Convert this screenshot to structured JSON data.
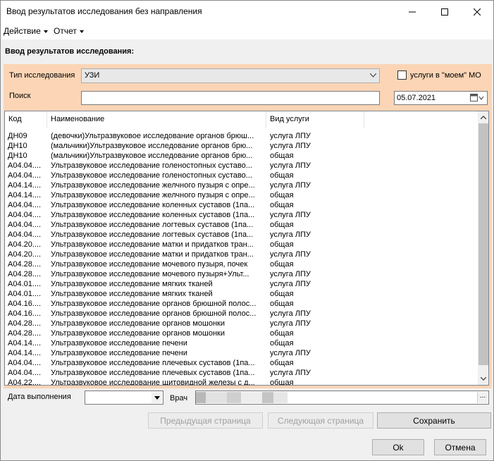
{
  "window": {
    "title": "Ввод результатов исследования без направления"
  },
  "menu": {
    "items": [
      {
        "label": "Действие"
      },
      {
        "label": "Отчет"
      }
    ]
  },
  "section_title": "Ввод результатов исследования:",
  "form": {
    "study_type_label": "Тип исследования",
    "study_type_value": "УЗИ",
    "my_mo_label": "услуги в \"моем\" МО",
    "my_mo_checked": false,
    "search_label": "Поиск",
    "search_value": "",
    "date_value": "05.07.2021"
  },
  "table": {
    "headers": [
      "Код",
      "Наименование",
      "Вид услуги"
    ],
    "rows": [
      {
        "code": "ДН09",
        "name": "(девочки)Ультразвуковое исследование органов брюш...",
        "type": "услуга ЛПУ"
      },
      {
        "code": "ДН10",
        "name": "(мальчики)Ультразвуковое исследование органов брю...",
        "type": "услуга ЛПУ"
      },
      {
        "code": "ДН10",
        "name": "(мальчики)Ультразвуковое исследование органов брю...",
        "type": "общая"
      },
      {
        "code": "A04.04....",
        "name": "Ультразвуковое исследование голеностопных суставо...",
        "type": "услуга ЛПУ"
      },
      {
        "code": "A04.04....",
        "name": "Ультразвуковое исследование голеностопных суставо...",
        "type": "общая"
      },
      {
        "code": "A04.14....",
        "name": "Ультразвуковое исследование желчного пузыря с опре...",
        "type": "услуга ЛПУ"
      },
      {
        "code": "A04.14....",
        "name": "Ультразвуковое исследование желчного пузыря с опре...",
        "type": "общая"
      },
      {
        "code": "A04.04....",
        "name": "Ультразвуковое исследование коленных суставов (1па...",
        "type": "общая"
      },
      {
        "code": "A04.04....",
        "name": "Ультразвуковое исследование коленных суставов (1па...",
        "type": "услуга ЛПУ"
      },
      {
        "code": "A04.04....",
        "name": "Ультразвуковое исследование логтевых суставов (1па...",
        "type": "общая"
      },
      {
        "code": "A04.04....",
        "name": "Ультразвуковое исследование логтевых суставов (1па...",
        "type": "услуга ЛПУ"
      },
      {
        "code": "A04.20....",
        "name": "Ультразвуковое исследование матки и придатков тран...",
        "type": "общая"
      },
      {
        "code": "A04.20....",
        "name": "Ультразвуковое исследование матки и придатков тран...",
        "type": "услуга ЛПУ"
      },
      {
        "code": "A04.28....",
        "name": "Ультразвуковое исследование мочевого пузыря, почек",
        "type": "общая"
      },
      {
        "code": "A04.28....",
        "name": "Ультразвуковое исследование мочевого пузыря+Ульт...",
        "type": "услуга ЛПУ"
      },
      {
        "code": "A04.01....",
        "name": "Ультразвуковое исследование мягких тканей",
        "type": "услуга ЛПУ"
      },
      {
        "code": "A04.01....",
        "name": "Ультразвуковое исследование мягких тканей",
        "type": "общая"
      },
      {
        "code": "A04.16....",
        "name": "Ультразвуковое исследование органов брюшной полос...",
        "type": "общая"
      },
      {
        "code": "A04.16....",
        "name": "Ультразвуковое исследование органов брюшной полос...",
        "type": "услуга ЛПУ"
      },
      {
        "code": "A04.28....",
        "name": "Ультразвуковое исследование органов мошонки",
        "type": "услуга ЛПУ"
      },
      {
        "code": "A04.28....",
        "name": "Ультразвуковое исследование органов мошонки",
        "type": "общая"
      },
      {
        "code": "A04.14....",
        "name": "Ультразвуковое исследование печени",
        "type": "общая"
      },
      {
        "code": "A04.14....",
        "name": "Ультразвуковое исследование печени",
        "type": "услуга ЛПУ"
      },
      {
        "code": "A04.04....",
        "name": "Ультразвуковое исследование плечевых суставов (1па...",
        "type": "общая"
      },
      {
        "code": "A04.04....",
        "name": "Ультразвуковое исследование плечевых суставов (1па...",
        "type": "услуга ЛПУ"
      },
      {
        "code": "A04.22....",
        "name": "Ультразвуковое исследование щитовидной железы с д...",
        "type": "общая"
      }
    ]
  },
  "bottom": {
    "date_label": "Дата выполнения",
    "date_value": "",
    "doctor_label": "Врач",
    "doctor_button": "..."
  },
  "buttons": {
    "prev_page": "Предыдущая страница",
    "next_page": "Следующая страница",
    "save": "Сохранить",
    "ok": "Ok",
    "cancel": "Отмена"
  },
  "colors": {
    "panel": "#fbd5b5",
    "background": "#f0f0f0"
  }
}
